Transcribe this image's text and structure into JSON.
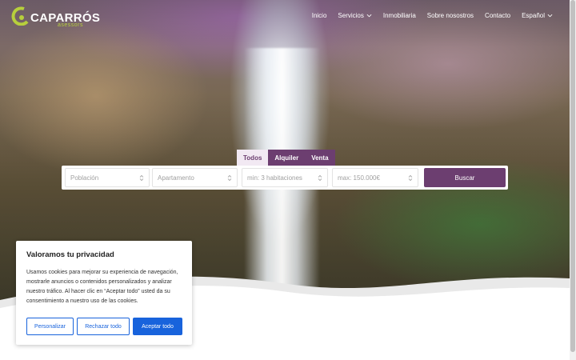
{
  "brand": {
    "name": "CAPARRÓS",
    "tagline": "asessors",
    "accent_color": "#b7cf3c"
  },
  "nav": {
    "items": [
      {
        "label": "Inicio"
      },
      {
        "label": "Servicios",
        "icon": "chevron-down-icon"
      },
      {
        "label": "Inmobiliaria"
      },
      {
        "label": "Sobre nosostros"
      },
      {
        "label": "Contacto"
      },
      {
        "label": "Español",
        "icon": "chevron-down-icon"
      }
    ]
  },
  "search": {
    "tabs": [
      {
        "label": "Todos",
        "active": true
      },
      {
        "label": "Alquiler",
        "active": false
      },
      {
        "label": "Venta",
        "active": false
      }
    ],
    "fields": {
      "location": {
        "placeholder": "Población"
      },
      "type": {
        "placeholder": "Apartamento"
      },
      "rooms": {
        "placeholder": "min: 3 habitaciones"
      },
      "price": {
        "placeholder": "max: 150.000€"
      }
    },
    "button_label": "Buscar",
    "brand_color": "#6c3e70"
  },
  "cookie": {
    "title": "Valoramos tu privacidad",
    "text": "Usamos cookies para mejorar su experiencia de navegación, mostrarle anuncios o contenidos personalizados y analizar nuestro tráfico. Al hacer clic en “Aceptar todo” usted da su consentimiento a nuestro uso de las cookies.",
    "buttons": {
      "customize": "Personalizar",
      "reject": "Rechazar todo",
      "accept": "Aceptar todo"
    },
    "button_color": "#1863dc"
  }
}
